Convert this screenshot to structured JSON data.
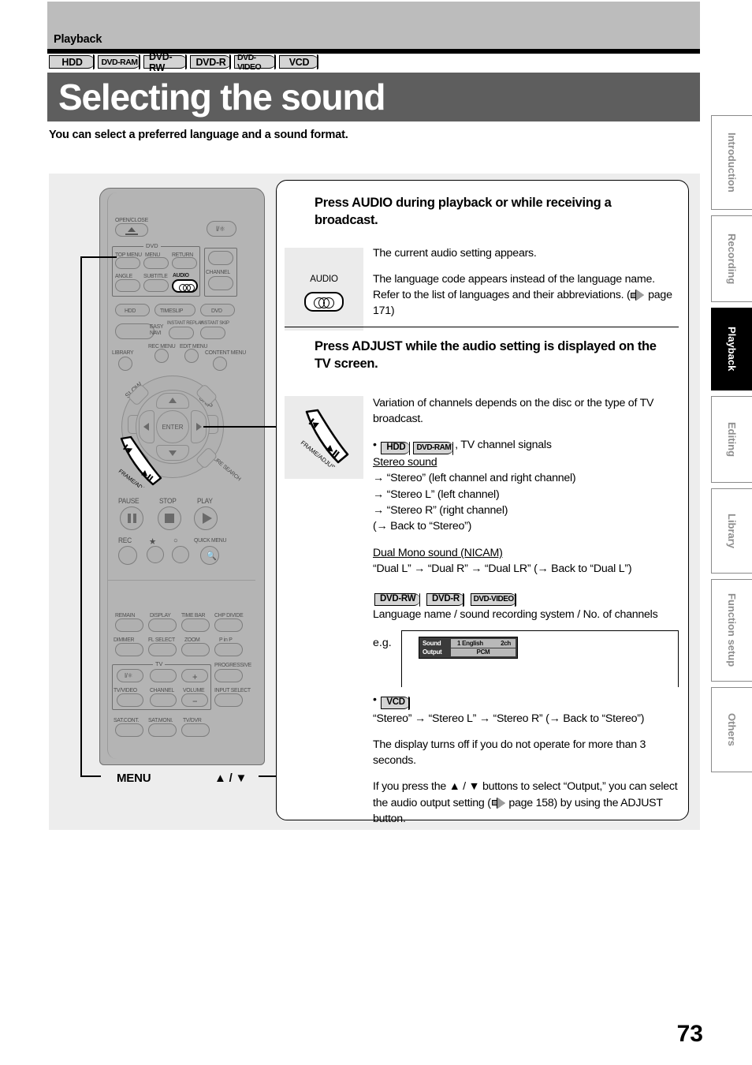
{
  "header": {
    "section": "Playback",
    "title": "Selecting the sound",
    "lede": "You can select a preferred language and a sound format.",
    "badges": [
      "HDD",
      "DVD-RAM",
      "DVD-RW",
      "DVD-R",
      "DVD-VIDEO",
      "VCD"
    ]
  },
  "tabs": [
    {
      "label": "Introduction",
      "active": false
    },
    {
      "label": "Recording",
      "active": false
    },
    {
      "label": "Playback",
      "active": true
    },
    {
      "label": "Editing",
      "active": false
    },
    {
      "label": "Library",
      "active": false
    },
    {
      "label": "Function setup",
      "active": false
    },
    {
      "label": "Others",
      "active": false
    }
  ],
  "steps": {
    "step1": {
      "heading": "Press AUDIO during playback or while receiving a broadcast.",
      "figure_label": "AUDIO",
      "para1": "The current audio setting appears.",
      "para2_a": "The language code appears instead of the language name. Refer to the list of languages and their abbreviations. (",
      "para2_page": " page 171)"
    },
    "step2": {
      "heading": "Press ADJUST while the audio setting is displayed on the TV screen.",
      "figure_label": "FRAME/ADJUST",
      "para1": "Variation of channels depends on the disc or the type of TV broadcast.",
      "bullet1_badges": [
        "HDD",
        "DVD-RAM"
      ],
      "bullet1_tail": ", TV channel signals",
      "stereo_heading": "Stereo sound",
      "stereo_lines": [
        "→ “Stereo” (left channel and right channel)",
        "→ “Stereo L” (left channel)",
        "→ “Stereo R” (right channel)",
        "(→ Back to “Stereo”)"
      ],
      "dual_heading": "Dual Mono sound (NICAM)",
      "dual_line": "“Dual L” → “Dual R” → “Dual LR” (→ Back to “Dual L”)",
      "disc_badges": [
        "DVD-RW",
        "DVD-R",
        "DVD-VIDEO"
      ],
      "disc_text": "Language name / sound recording system / No. of channels",
      "eg_label": "e.g.",
      "osd": {
        "row1_key": "Sound",
        "row1_val_left": "1  English",
        "row1_val_right": "2ch",
        "row2_key": "Output",
        "row2_val": "PCM"
      },
      "vcd_badge": "VCD",
      "vcd_line": "“Stereo” → “Stereo L” → “Stereo R” (→ Back to “Stereo”)",
      "para_timeout": "The display turns off if you do not operate for more than 3 seconds.",
      "para_output_a": "If you press the ▲ / ▼ buttons to select “Output,” you can select the audio output setting (",
      "para_output_page": " page 158) by using the ADJUST button."
    }
  },
  "remote": {
    "callout_menu": "MENU",
    "callout_updown": "▲ / ▼",
    "labels": {
      "open_close": "OPEN/CLOSE",
      "dvd_group": "DVD",
      "top_menu": "TOP MENU",
      "menu": "MENU",
      "return": "RETURN",
      "angle": "ANGLE",
      "subtitle": "SUBTITLE",
      "audio": "AUDIO",
      "channel": "CHANNEL",
      "hdd": "HDD",
      "timeslip": "TIMESLIP",
      "dvd": "DVD",
      "easy_navi": "EASY\nNAVI",
      "instant_replay": "INSTANT REPLAY",
      "instant_skip": "INSTANT SKIP",
      "rec_menu": "REC MENU",
      "edit_menu": "EDIT MENU",
      "library": "LIBRARY",
      "content_menu": "CONTENT MENU",
      "slow": "SLOW",
      "skip": "SKIP",
      "enter": "ENTER",
      "frame_adjust": "FRAME/ADJUST",
      "picture_search": "PICTURE SEARCH",
      "pause": "PAUSE",
      "stop": "STOP",
      "play": "PLAY",
      "rec": "REC",
      "quick_menu": "QUICK MENU",
      "remain": "REMAIN",
      "display": "DISPLAY",
      "time_bar": "TIME BAR",
      "chp_divide": "CHP DIVIDE",
      "dimmer": "DIMMER",
      "fl_select": "FL SELECT",
      "zoom": "ZOOM",
      "p_in_p": "P in P",
      "tv_group": "TV",
      "progressive": "PROGRESSIVE",
      "tv_video": "TV/VIDEO",
      "tv_channel": "CHANNEL",
      "volume": "VOLUME",
      "input_select": "INPUT SELECT",
      "sat_cont": "SAT.CONT.",
      "sat_moni": "SAT.MONI.",
      "tv_dvr": "TV/DVR"
    }
  },
  "page_number": "73"
}
